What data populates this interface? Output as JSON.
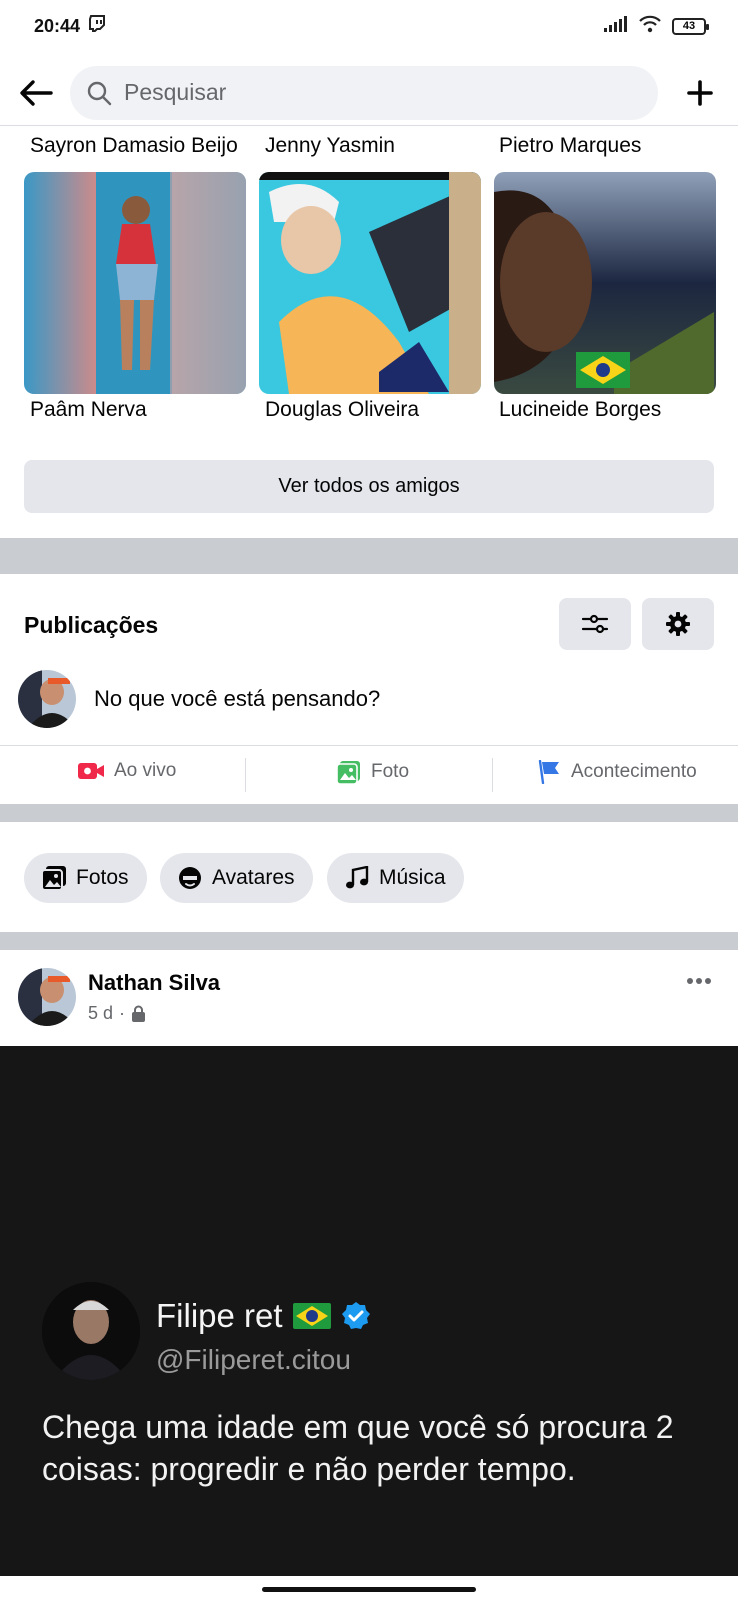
{
  "status_bar": {
    "time": "20:44",
    "battery": "43"
  },
  "header": {
    "search_placeholder": "Pesquisar"
  },
  "friends": {
    "top_names": [
      "Sayron Damasio Beijo",
      "Jenny Yasmin",
      "Pietro Marques"
    ],
    "bottom_names": [
      "Paâm Nerva",
      "Douglas Oliveira",
      "Lucineide Borges"
    ],
    "see_all_label": "Ver todos os amigos"
  },
  "publications": {
    "title": "Publicações",
    "composer_placeholder": "No que você está pensando?",
    "actions": {
      "live": "Ao vivo",
      "photo": "Foto",
      "event": "Acontecimento"
    }
  },
  "chips": {
    "photos": "Fotos",
    "avatars": "Avatares",
    "music": "Música"
  },
  "post": {
    "author": "Nathan Silva",
    "time": "5 d",
    "quote": {
      "name": "Filipe ret",
      "handle": "@Filiperet.citou",
      "text": "Chega uma idade em que você só procura 2 coisas: progredir e não perder tempo."
    }
  },
  "colors": {
    "brand_blue": "#1877f2",
    "live_red": "#f02849",
    "photo_green": "#45bd62",
    "event_blue": "#3578e5"
  }
}
